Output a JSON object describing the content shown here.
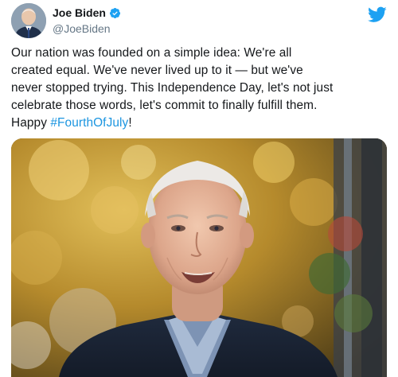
{
  "author": {
    "name": "Joe Biden",
    "handle": "@JoeBiden",
    "verified": true
  },
  "tweet": {
    "lines": [
      "Our nation was founded on a simple idea: We're all",
      "created equal. We've never lived up to it — but we've",
      "never stopped trying. This Independence Day, let's not just",
      "celebrate those words, let's commit to finally fulfill them."
    ],
    "last_line_prefix": "Happy ",
    "hashtag": "#FourthOfJuly",
    "last_line_suffix": "!"
  },
  "icons": {
    "platform": "twitter-bird-icon",
    "verified": "verified-badge-icon"
  },
  "colors": {
    "link": "#1b95e0",
    "brand": "#1da1f2",
    "text": "#14171a",
    "muted": "#657786"
  }
}
